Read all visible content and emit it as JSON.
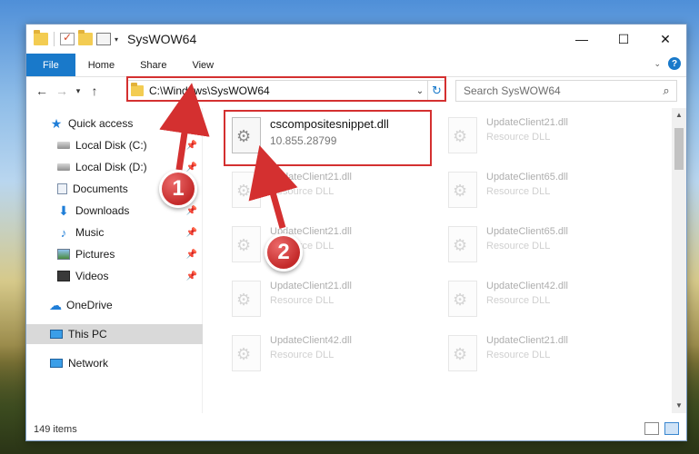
{
  "window": {
    "title": "SysWOW64",
    "controls": {
      "minimize": "—",
      "maximize": "☐",
      "close": "✕"
    }
  },
  "ribbon": {
    "tabs": [
      {
        "label": "File"
      },
      {
        "label": "Home"
      },
      {
        "label": "Share"
      },
      {
        "label": "View"
      }
    ],
    "help_label": "?"
  },
  "nav": {
    "address": "C:\\Windows\\SysWOW64",
    "search_placeholder": "Search SysWOW64"
  },
  "sidebar": {
    "items": [
      {
        "label": "Quick access",
        "icon": "star-icon"
      },
      {
        "label": "Local Disk (C:)",
        "icon": "disk-icon",
        "pinned": true
      },
      {
        "label": "Local Disk (D:)",
        "icon": "disk-icon",
        "pinned": true
      },
      {
        "label": "Documents",
        "icon": "documents-icon",
        "pinned": true
      },
      {
        "label": "Downloads",
        "icon": "download-icon",
        "pinned": true
      },
      {
        "label": "Music",
        "icon": "music-icon",
        "pinned": true
      },
      {
        "label": "Pictures",
        "icon": "pictures-icon",
        "pinned": true
      },
      {
        "label": "Videos",
        "icon": "videos-icon",
        "pinned": true
      },
      {
        "label": "OneDrive",
        "icon": "cloud-icon"
      },
      {
        "label": "This PC",
        "icon": "computer-icon",
        "selected": true
      },
      {
        "label": "Network",
        "icon": "network-icon"
      }
    ]
  },
  "files": [
    {
      "name": "cscompositesnippet.dll",
      "desc": "10.855.28799"
    },
    {
      "name": "UpdateClient21.dll",
      "desc": "Resource DLL"
    },
    {
      "name": "UpdateClient21.dll",
      "desc": "Resource DLL"
    },
    {
      "name": "UpdateClient65.dll",
      "desc": "Resource DLL"
    },
    {
      "name": "UpdateClient21.dll",
      "desc": "Resource DLL"
    },
    {
      "name": "UpdateClient65.dll",
      "desc": "Resource DLL"
    },
    {
      "name": "UpdateClient21.dll",
      "desc": "Resource DLL"
    },
    {
      "name": "UpdateClient42.dll",
      "desc": "Resource DLL"
    },
    {
      "name": "UpdateClient42.dll",
      "desc": "Resource DLL"
    },
    {
      "name": "UpdateClient21.dll",
      "desc": "Resource DLL"
    }
  ],
  "status": {
    "items_count": "149 items"
  },
  "callouts": {
    "one": "1",
    "two": "2"
  },
  "colors": {
    "accent": "#1979ca",
    "highlight": "#d43030",
    "callout": "#c42a2a"
  }
}
